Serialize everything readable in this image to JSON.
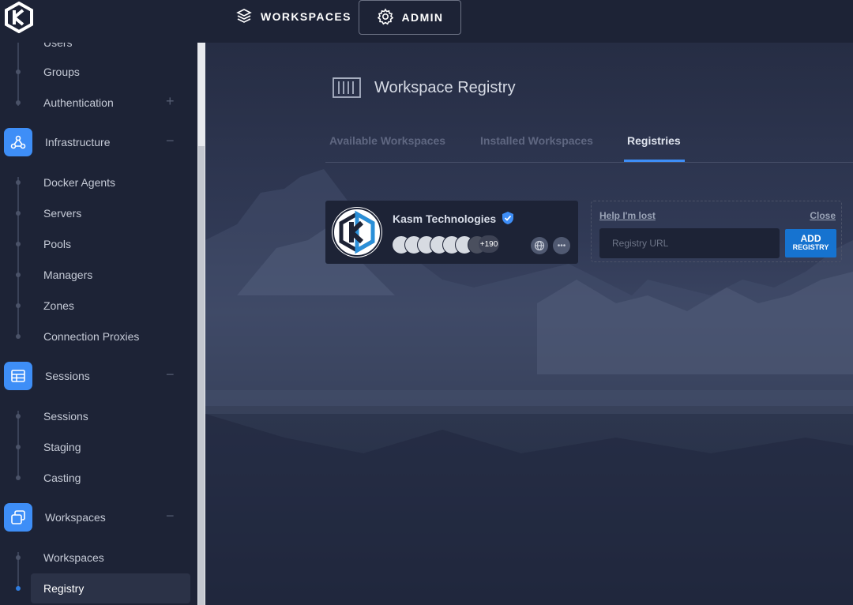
{
  "topbar": {
    "logo_icon": "kasm-logo-icon",
    "workspaces_label": "WORKSPACES",
    "workspaces_icon": "layers-icon",
    "admin_label": "ADMIN",
    "admin_icon": "gear-icon"
  },
  "sidebar": {
    "items_top": [
      "Users",
      "Groups",
      "Authentication"
    ],
    "sections": [
      {
        "label": "Infrastructure",
        "icon": "infrastructure-icon",
        "toggle": "−",
        "items": [
          "Docker Agents",
          "Servers",
          "Pools",
          "Managers",
          "Zones",
          "Connection Proxies"
        ]
      },
      {
        "label": "Sessions",
        "icon": "table-icon",
        "toggle": "−",
        "items": [
          "Sessions",
          "Staging",
          "Casting"
        ]
      },
      {
        "label": "Workspaces",
        "icon": "windows-icon",
        "toggle": "−",
        "items": [
          "Workspaces",
          "Registry"
        ]
      }
    ],
    "auth_toggle": "+",
    "active_item": "Registry"
  },
  "main": {
    "title": "Workspace Registry",
    "title_icon": "container-icon",
    "tabs": [
      "Available Workspaces",
      "Installed Workspaces",
      "Registries"
    ],
    "active_tab": "Registries",
    "registry_card": {
      "name": "Kasm Technologies",
      "verified_icon": "verified-badge-icon",
      "more_count": "+190",
      "actions": [
        "globe-icon",
        "ellipsis-icon"
      ]
    },
    "add_panel": {
      "help_link": "Help I'm lost",
      "close_link": "Close",
      "input_placeholder": "Registry URL",
      "button_line1": "ADD",
      "button_line2": "REGISTRY"
    }
  },
  "colors": {
    "accent": "#3e8ef7",
    "bg": "#1d2336",
    "button": "#1673d0"
  }
}
